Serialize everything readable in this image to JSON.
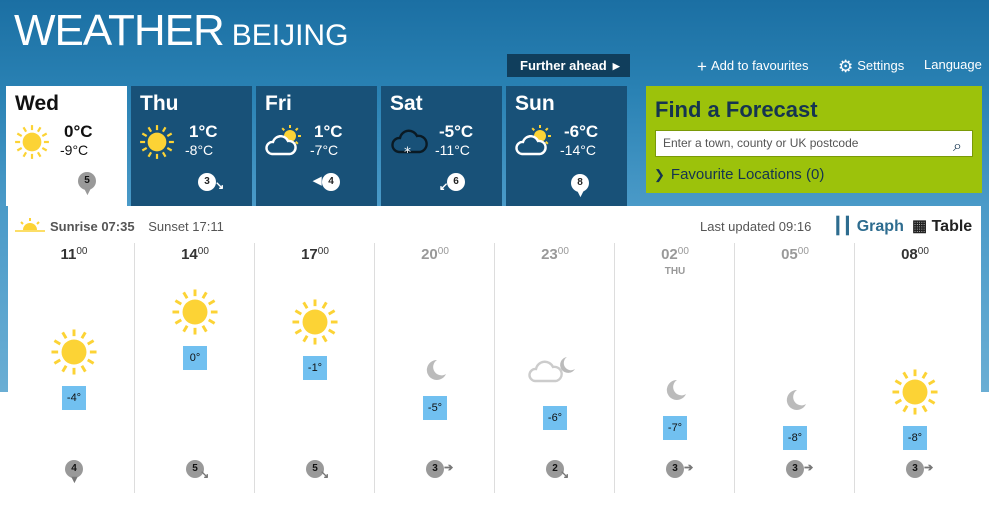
{
  "header": {
    "brand": "WEATHER",
    "location": "BEIJING"
  },
  "nav": {
    "further_ahead": "Further ahead",
    "add_favourites": "Add to favourites",
    "settings": "Settings",
    "language": "Language"
  },
  "days": [
    {
      "name": "Wed",
      "high": "0°C",
      "low": "-9°C",
      "icon": "sun-icon",
      "wind": "5",
      "wind_dir": "down"
    },
    {
      "name": "Thu",
      "high": "1°C",
      "low": "-8°C",
      "icon": "sun-icon",
      "wind": "3",
      "wind_dir": "down-right"
    },
    {
      "name": "Fri",
      "high": "1°C",
      "low": "-7°C",
      "icon": "sun-cloud-icon",
      "wind": "4",
      "wind_dir": "left"
    },
    {
      "name": "Sat",
      "high": "-5°C",
      "low": "-11°C",
      "icon": "snow-cloud-icon",
      "wind": "6",
      "wind_dir": "down-left"
    },
    {
      "name": "Sun",
      "high": "-6°C",
      "low": "-14°C",
      "icon": "sun-cloud-icon",
      "wind": "8",
      "wind_dir": "down"
    }
  ],
  "forecast_box": {
    "title": "Find a Forecast",
    "placeholder": "Enter a town, county or UK postcode",
    "favourites": "Favourite Locations (0)"
  },
  "sun": {
    "sunrise_label": "Sunrise",
    "sunrise": "07:35",
    "sunset_label": "Sunset",
    "sunset": "17:11"
  },
  "updated": "Last updated 09:16",
  "view": {
    "graph": "Graph",
    "table": "Table"
  },
  "hours": [
    {
      "hour": "11",
      "min": "00",
      "sub": "",
      "temp": "-4°",
      "temp_value": -4,
      "icon": "sun-icon",
      "wind": "4",
      "wind_dir": "down"
    },
    {
      "hour": "14",
      "min": "00",
      "sub": "",
      "temp": "0°",
      "temp_value": 0,
      "icon": "sun-icon",
      "wind": "5",
      "wind_dir": "down-right"
    },
    {
      "hour": "17",
      "min": "00",
      "sub": "",
      "temp": "-1°",
      "temp_value": -1,
      "icon": "sun-icon",
      "wind": "5",
      "wind_dir": "down-right"
    },
    {
      "hour": "20",
      "min": "00",
      "sub": "",
      "temp": "-5°",
      "temp_value": -5,
      "icon": "moon-icon",
      "wind": "3",
      "wind_dir": "right"
    },
    {
      "hour": "23",
      "min": "00",
      "sub": "",
      "temp": "-6°",
      "temp_value": -6,
      "icon": "moon-cloud-icon",
      "wind": "2",
      "wind_dir": "down-right"
    },
    {
      "hour": "02",
      "min": "00",
      "sub": "THU",
      "temp": "-7°",
      "temp_value": -7,
      "icon": "moon-icon",
      "wind": "3",
      "wind_dir": "right"
    },
    {
      "hour": "05",
      "min": "00",
      "sub": "",
      "temp": "-8°",
      "temp_value": -8,
      "icon": "moon-icon",
      "wind": "3",
      "wind_dir": "right"
    },
    {
      "hour": "08",
      "min": "00",
      "sub": "",
      "temp": "-8°",
      "temp_value": -8,
      "icon": "sun-icon",
      "wind": "3",
      "wind_dir": "right"
    }
  ],
  "colors": {
    "header_blue": "#185178",
    "dark_tab": "#103e5c",
    "forecast_green": "#9cc20b",
    "temp_box": "#71c0f0",
    "sun_yellow": "#fcd335"
  }
}
